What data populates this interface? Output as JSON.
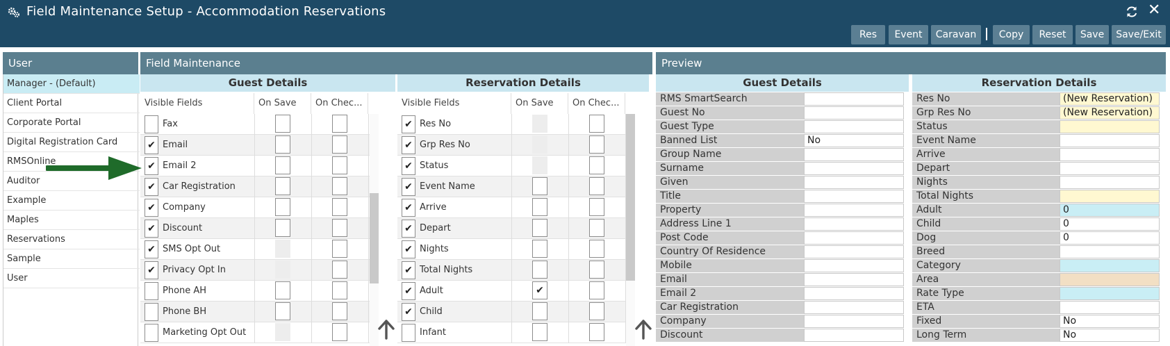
{
  "window": {
    "title": "Field Maintenance Setup - Accommodation Reservations"
  },
  "toolbar": {
    "res_label": "Res",
    "event_label": "Event",
    "caravan_label": "Caravan",
    "copy_label": "Copy",
    "reset_label": "Reset",
    "save_label": "Save",
    "save_exit_label": "Save/Exit"
  },
  "icons": {
    "header": "gears-icon",
    "refresh": "refresh-icon",
    "close": "close-icon",
    "close_glyph": "✕",
    "check_glyph": "✔",
    "scroll": "up-arrow-icon",
    "annotation": "green-arrow-icon"
  },
  "colors": {
    "header_bg": "#1e4a66",
    "toolbar_button": "#5b7f93",
    "panel_header": "#5b7f8f",
    "section_header": "#c9e6f0",
    "selected_row": "#c9ecf4",
    "annotation_arrow": "#1f6b2a"
  },
  "user_panel": {
    "title": "User",
    "items": [
      {
        "label": "Manager - (Default)",
        "selected": true
      },
      {
        "label": "Client Portal"
      },
      {
        "label": "Corporate Portal"
      },
      {
        "label": "Digital Registration Card"
      },
      {
        "label": "RMSOnline"
      },
      {
        "label": "Auditor"
      },
      {
        "label": "Example"
      },
      {
        "label": "Maples"
      },
      {
        "label": "Reservations"
      },
      {
        "label": "Sample"
      },
      {
        "label": "User"
      }
    ]
  },
  "field_panel": {
    "title": "Field Maintenance",
    "guest": {
      "heading": "Guest Details",
      "col_visible": "Visible Fields",
      "col_on_save": "On Save",
      "col_on_check": "On Chec...",
      "rows": [
        {
          "label": "Fax",
          "visible": false,
          "save": "empty",
          "check": "empty"
        },
        {
          "label": "Email",
          "visible": true,
          "save": "empty",
          "check": "empty"
        },
        {
          "label": "Email 2",
          "visible": true,
          "save": "empty",
          "check": "empty"
        },
        {
          "label": "Car Registration",
          "visible": true,
          "save": "empty",
          "check": "empty"
        },
        {
          "label": "Company",
          "visible": true,
          "save": "empty",
          "check": "empty"
        },
        {
          "label": "Discount",
          "visible": true,
          "save": "empty",
          "check": "empty"
        },
        {
          "label": "SMS Opt Out",
          "visible": true,
          "save": "disabled",
          "check": "empty"
        },
        {
          "label": "Privacy Opt In",
          "visible": true,
          "save": "disabled",
          "check": "empty"
        },
        {
          "label": "Phone AH",
          "visible": false,
          "save": "empty",
          "check": "empty"
        },
        {
          "label": "Phone BH",
          "visible": false,
          "save": "empty",
          "check": "empty"
        },
        {
          "label": "Marketing Opt Out",
          "visible": false,
          "save": "disabled",
          "check": "empty"
        }
      ]
    },
    "reservation": {
      "heading": "Reservation Details",
      "col_visible": "Visible Fields",
      "col_on_save": "On Save",
      "col_on_check": "On Chec...",
      "rows": [
        {
          "label": "Res No",
          "visible": true,
          "save": "disabled",
          "check": "empty"
        },
        {
          "label": "Grp Res No",
          "visible": true,
          "save": "disabled",
          "check": "empty"
        },
        {
          "label": "Status",
          "visible": true,
          "save": "disabled",
          "check": "empty"
        },
        {
          "label": "Event Name",
          "visible": true,
          "save": "empty",
          "check": "empty"
        },
        {
          "label": "Arrive",
          "visible": true,
          "save": "empty",
          "check": "empty"
        },
        {
          "label": "Depart",
          "visible": true,
          "save": "empty",
          "check": "empty"
        },
        {
          "label": "Nights",
          "visible": true,
          "save": "empty",
          "check": "empty"
        },
        {
          "label": "Total Nights",
          "visible": true,
          "save": "empty",
          "check": "empty"
        },
        {
          "label": "Adult",
          "visible": true,
          "save": "checked",
          "check": "empty"
        },
        {
          "label": "Child",
          "visible": true,
          "save": "empty",
          "check": "empty"
        },
        {
          "label": "Infant",
          "visible": false,
          "save": "empty",
          "check": "empty"
        }
      ]
    }
  },
  "preview_panel": {
    "title": "Preview",
    "guest": {
      "heading": "Guest Details",
      "rows": [
        {
          "label": "RMS SmartSearch",
          "value": ""
        },
        {
          "label": "Guest No",
          "value": ""
        },
        {
          "label": "Guest Type",
          "value": ""
        },
        {
          "label": "Banned List",
          "value": "No"
        },
        {
          "label": "Group Name",
          "value": ""
        },
        {
          "label": "Surname",
          "value": ""
        },
        {
          "label": "Given",
          "value": ""
        },
        {
          "label": "Title",
          "value": ""
        },
        {
          "label": "Property",
          "value": ""
        },
        {
          "label": "Address Line 1",
          "value": ""
        },
        {
          "label": "Post Code",
          "value": ""
        },
        {
          "label": "Country Of Residence",
          "value": ""
        },
        {
          "label": "Mobile",
          "value": ""
        },
        {
          "label": "Email",
          "value": ""
        },
        {
          "label": "Email 2",
          "value": ""
        },
        {
          "label": "Car Registration",
          "value": ""
        },
        {
          "label": "Company",
          "value": ""
        },
        {
          "label": "Discount",
          "value": ""
        }
      ]
    },
    "reservation": {
      "heading": "Reservation Details",
      "rows": [
        {
          "label": "Res No",
          "value": "(New Reservation)",
          "tone": "yellow"
        },
        {
          "label": "Grp Res No",
          "value": "(New Reservation)",
          "tone": "yellow"
        },
        {
          "label": "Status",
          "value": "",
          "tone": "yellow"
        },
        {
          "label": "Event Name",
          "value": "",
          "tone": ""
        },
        {
          "label": "Arrive",
          "value": "",
          "tone": ""
        },
        {
          "label": "Depart",
          "value": "",
          "tone": ""
        },
        {
          "label": "Nights",
          "value": "",
          "tone": ""
        },
        {
          "label": "Total Nights",
          "value": "",
          "tone": "yellow"
        },
        {
          "label": "Adult",
          "value": "0",
          "tone": "blue"
        },
        {
          "label": "Child",
          "value": "0",
          "tone": ""
        },
        {
          "label": "Dog",
          "value": "0",
          "tone": ""
        },
        {
          "label": "Breed",
          "value": "",
          "tone": ""
        },
        {
          "label": "Category",
          "value": "",
          "tone": "blue"
        },
        {
          "label": "Area",
          "value": "",
          "tone": "tan"
        },
        {
          "label": "Rate Type",
          "value": "",
          "tone": "blue"
        },
        {
          "label": "ETA",
          "value": "",
          "tone": ""
        },
        {
          "label": "Fixed",
          "value": "No",
          "tone": ""
        },
        {
          "label": "Long Term",
          "value": "No",
          "tone": ""
        }
      ]
    }
  }
}
